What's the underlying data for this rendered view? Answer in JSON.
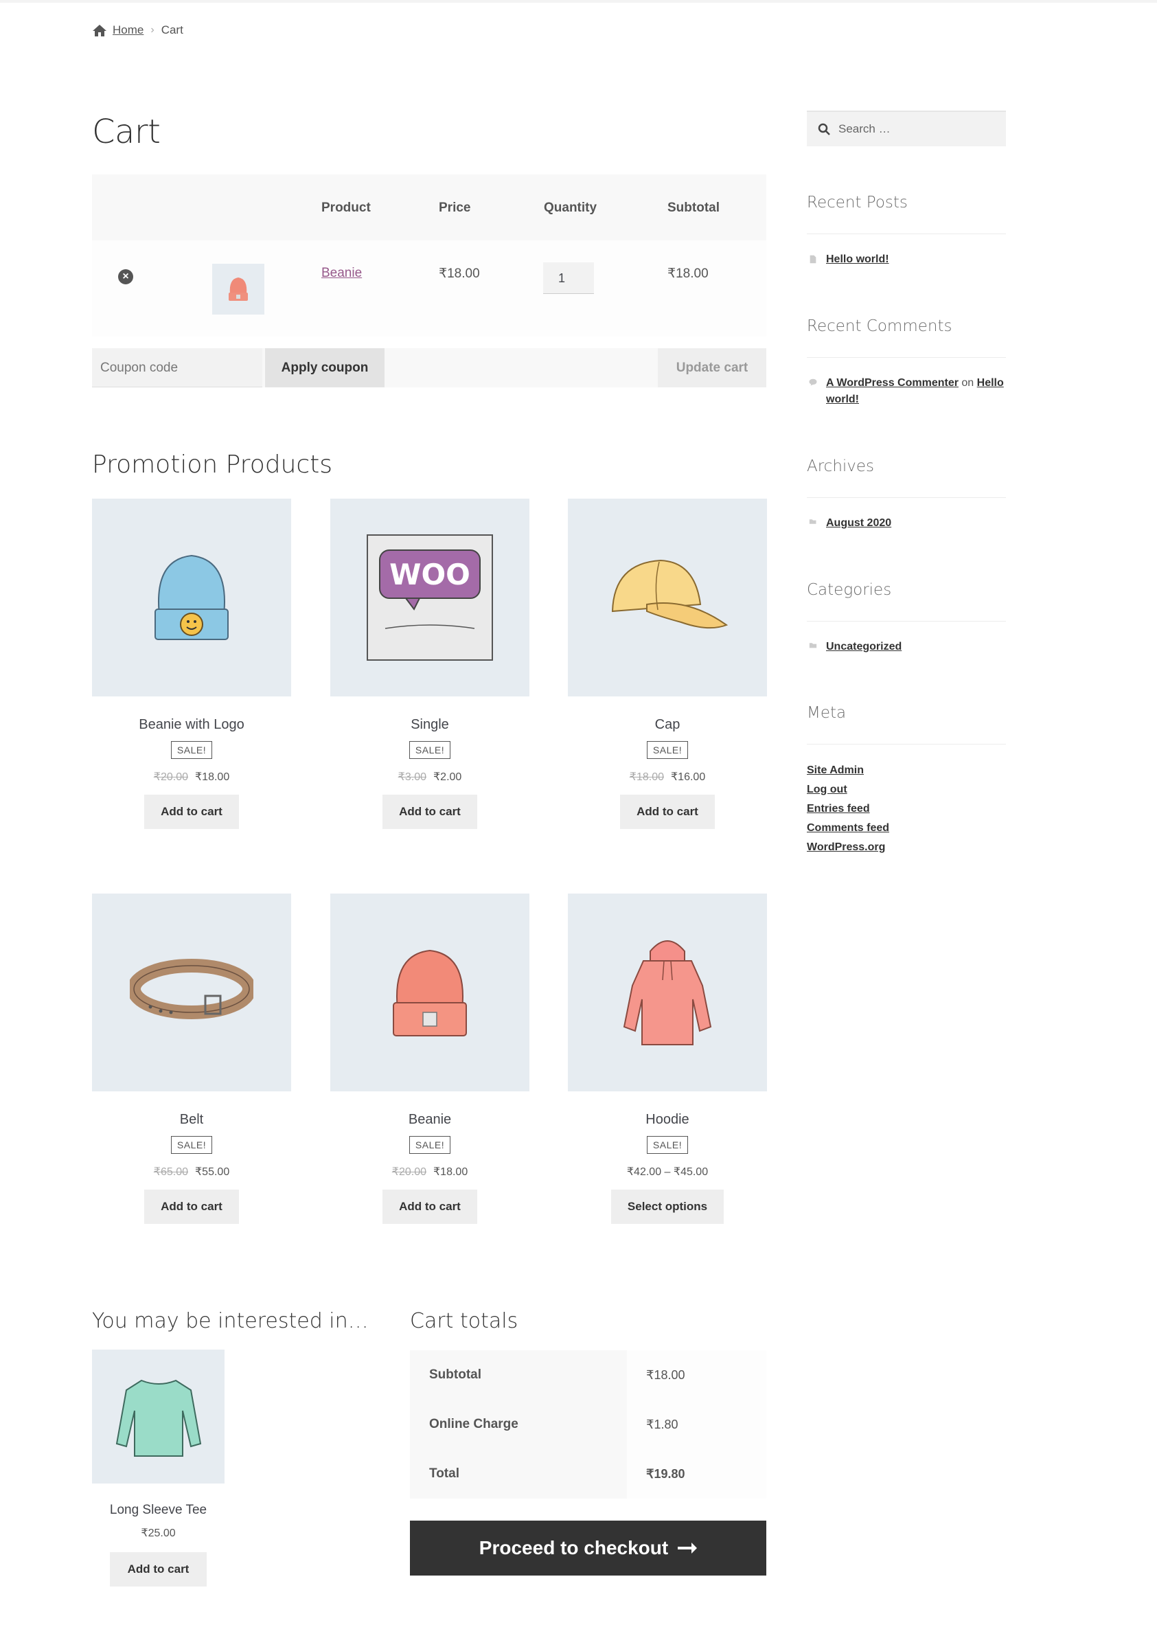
{
  "breadcrumb": {
    "home": "Home",
    "separator": "›",
    "current": "Cart"
  },
  "page_title": "Cart",
  "cart_table": {
    "headers": {
      "product": "Product",
      "price": "Price",
      "quantity": "Quantity",
      "subtotal": "Subtotal"
    },
    "rows": [
      {
        "remove_icon": "close-circle-icon",
        "product": "Beanie",
        "price": "₹18.00",
        "quantity": "1",
        "subtotal": "₹18.00"
      }
    ]
  },
  "coupon": {
    "placeholder": "Coupon code",
    "apply_label": "Apply coupon",
    "update_label": "Update cart"
  },
  "promotion": {
    "title": "Promotion Products",
    "products": [
      {
        "name": "Beanie with Logo",
        "badge": "SALE!",
        "old_price": "₹20.00",
        "price": "₹18.00",
        "button": "Add to cart"
      },
      {
        "name": "Single",
        "badge": "SALE!",
        "old_price": "₹3.00",
        "price": "₹2.00",
        "button": "Add to cart"
      },
      {
        "name": "Cap",
        "badge": "SALE!",
        "old_price": "₹18.00",
        "price": "₹16.00",
        "button": "Add to cart"
      },
      {
        "name": "Belt",
        "badge": "SALE!",
        "old_price": "₹65.00",
        "price": "₹55.00",
        "button": "Add to cart"
      },
      {
        "name": "Beanie",
        "badge": "SALE!",
        "old_price": "₹20.00",
        "price": "₹18.00",
        "button": "Add to cart"
      },
      {
        "name": "Hoodie",
        "badge": "SALE!",
        "old_price": "",
        "price": "₹42.00 – ₹45.00",
        "button": "Select options"
      }
    ]
  },
  "cross_sells": {
    "title": "You may be interested in…",
    "product": {
      "name": "Long Sleeve Tee",
      "price": "₹25.00",
      "button": "Add to cart"
    }
  },
  "cart_totals": {
    "title": "Cart totals",
    "rows": [
      {
        "label": "Subtotal",
        "value": "₹18.00"
      },
      {
        "label": "Online Charge",
        "value": "₹1.80"
      },
      {
        "label": "Total",
        "value": "₹19.80"
      }
    ],
    "checkout_label": "Proceed to checkout",
    "checkout_icon": "arrow-right-icon"
  },
  "sidebar": {
    "search_placeholder": "Search …",
    "recent_posts": {
      "title": "Recent Posts",
      "items": [
        "Hello world!"
      ]
    },
    "recent_comments": {
      "title": "Recent Comments",
      "author": "A WordPress Commenter",
      "on": "on",
      "post_line1": "Hello",
      "post_line2": "world!"
    },
    "archives": {
      "title": "Archives",
      "items": [
        "August 2020"
      ]
    },
    "categories": {
      "title": "Categories",
      "items": [
        "Uncategorized"
      ]
    },
    "meta": {
      "title": "Meta",
      "links": [
        "Site Admin",
        "Log out",
        "Entries feed",
        "Comments feed",
        "WordPress.org"
      ]
    }
  },
  "colors": {
    "text": "#43454b",
    "button_dark": "#333333",
    "image_bg": "#e6ecf1",
    "link_purple": "#96588a"
  }
}
